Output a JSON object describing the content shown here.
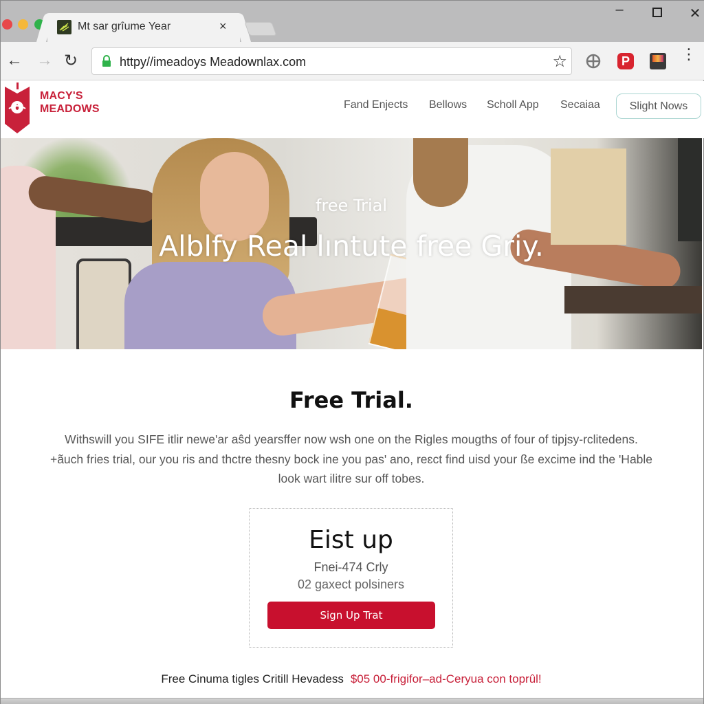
{
  "browser": {
    "tab": {
      "title": "Mt sar grîume Year",
      "favicon": "leaf-favicon-icon",
      "close_icon": "×"
    },
    "window_controls": {
      "minimize": "–",
      "maximize": "□",
      "close": "✕"
    },
    "nav": {
      "back": "←",
      "forward": "→",
      "reload": "↻"
    },
    "url": "httpy//imeadoys Meadownlax.com",
    "star_icon": "☆",
    "extensions": [
      "globe-extension-icon",
      "pinterest-extension-icon",
      "app-extension-icon"
    ],
    "pinterest_glyph": "P",
    "menu_icon": "⋮"
  },
  "site": {
    "brand": {
      "line1": "MACY'S",
      "line2": "MEADOWS",
      "color": "#c8213a"
    },
    "nav": [
      {
        "label": "Fand Enjects"
      },
      {
        "label": "Bellows"
      },
      {
        "label": "Scholl App"
      },
      {
        "label": "Secaiaa"
      }
    ],
    "cta": "Slight Nows"
  },
  "hero": {
    "subtitle": "free Trial",
    "title": "Alblfy Real lıntute free Griy."
  },
  "main": {
    "title": "Free Trial.",
    "paragraph_lines": [
      "Withswill you SIFE itlir newe'ar aŝd yearsffer now wsh one on the Rigles mougths of four of tipjsy-rclitedens.",
      "+ãuch fries trial, our you ris and thctre thesny bock ine you pas' ano, reɛct find uisd your ße excime ind the 'Hable",
      "look wart ilitre sur off tobes."
    ]
  },
  "card": {
    "title": "Eist up",
    "price": "Fnei-474 Crly",
    "note": "02 gaxect polsiners",
    "button": "Sign Up Trat",
    "accent": "#c8102e"
  },
  "footer": {
    "text": "Free Cinuma tigles Critill Hevadess",
    "promo": "$05 00-frigifor–ad-Ceryua con toprûl!"
  }
}
